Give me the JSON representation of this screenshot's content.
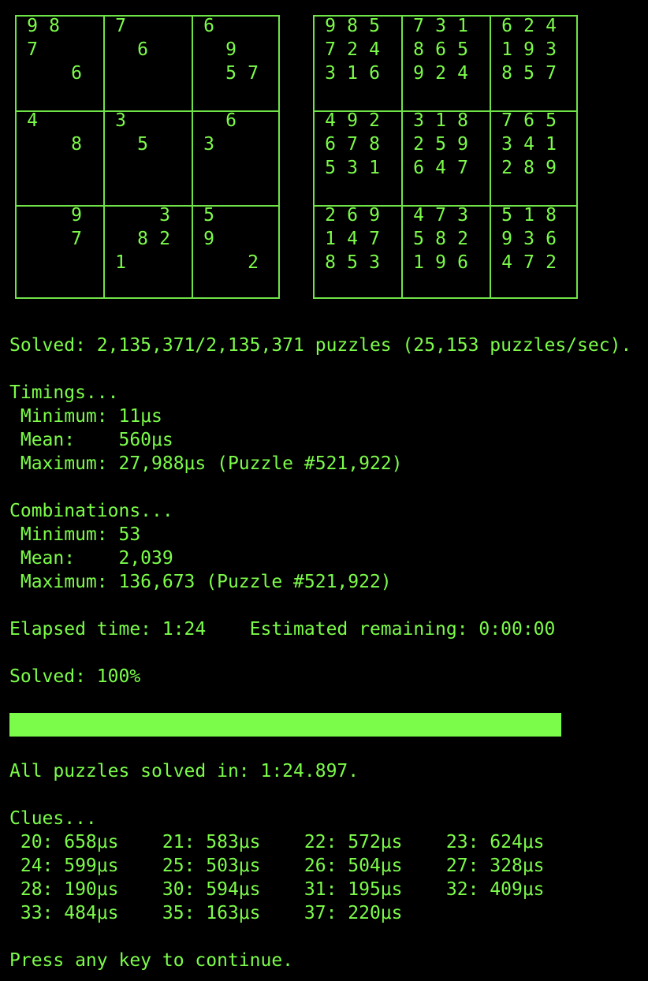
{
  "colors": {
    "background": "#000000",
    "text": "#7cfc4a",
    "grid": "#6fe347"
  },
  "puzzle": [
    [
      "9",
      "8",
      "",
      "7",
      "",
      "",
      "6",
      "",
      ""
    ],
    [
      "7",
      "",
      "",
      "",
      "6",
      "",
      "",
      "9",
      ""
    ],
    [
      "",
      "",
      "6",
      "",
      "",
      "",
      "",
      "5",
      "7"
    ],
    [
      "4",
      "",
      "",
      "3",
      "",
      "",
      "",
      "6",
      ""
    ],
    [
      "",
      "",
      "8",
      "",
      "5",
      "",
      "3",
      "",
      ""
    ],
    [
      "",
      "",
      "",
      "",
      "",
      "",
      "",
      "",
      ""
    ],
    [
      "",
      "",
      "9",
      "",
      "",
      "3",
      "5",
      "",
      ""
    ],
    [
      "",
      "",
      "7",
      "",
      "8",
      "2",
      "9",
      "",
      ""
    ],
    [
      "",
      "",
      "",
      "1",
      "",
      "",
      "",
      "",
      "2"
    ]
  ],
  "solution": [
    [
      "9",
      "8",
      "5",
      "7",
      "3",
      "1",
      "6",
      "2",
      "4"
    ],
    [
      "7",
      "2",
      "4",
      "8",
      "6",
      "5",
      "1",
      "9",
      "3"
    ],
    [
      "3",
      "1",
      "6",
      "9",
      "2",
      "4",
      "8",
      "5",
      "7"
    ],
    [
      "4",
      "9",
      "2",
      "3",
      "1",
      "8",
      "7",
      "6",
      "5"
    ],
    [
      "6",
      "7",
      "8",
      "2",
      "5",
      "9",
      "3",
      "4",
      "1"
    ],
    [
      "5",
      "3",
      "1",
      "6",
      "4",
      "7",
      "2",
      "8",
      "9"
    ],
    [
      "2",
      "6",
      "9",
      "4",
      "7",
      "3",
      "5",
      "1",
      "8"
    ],
    [
      "1",
      "4",
      "7",
      "5",
      "8",
      "2",
      "9",
      "3",
      "6"
    ],
    [
      "8",
      "5",
      "3",
      "1",
      "9",
      "6",
      "4",
      "7",
      "2"
    ]
  ],
  "summary": "Solved: 2,135,371/2,135,371 puzzles (25,153 puzzles/sec).",
  "timings": {
    "header": "Timings...",
    "minimum": " Minimum: 11μs",
    "mean": " Mean:    560μs",
    "maximum": " Maximum: 27,988μs (Puzzle #521,922)"
  },
  "combinations": {
    "header": "Combinations...",
    "minimum": " Minimum: 53",
    "mean": " Mean:    2,039",
    "maximum": " Maximum: 136,673 (Puzzle #521,922)"
  },
  "elapsed_line": "Elapsed time: 1:24    Estimated remaining: 0:00:00",
  "solved_percent_line": "Solved: 100%",
  "progress": {
    "fraction": 1.0
  },
  "all_solved_line": "All puzzles solved in: 1:24.897.",
  "clues": {
    "header": "Clues...",
    "rows": [
      " 20: 658μs    21: 583μs    22: 572μs    23: 624μs",
      " 24: 599μs    25: 503μs    26: 504μs    27: 328μs",
      " 28: 190μs    30: 594μs    31: 195μs    32: 409μs",
      " 33: 484μs    35: 163μs    37: 220μs"
    ]
  },
  "prompt": "Press any key to continue."
}
